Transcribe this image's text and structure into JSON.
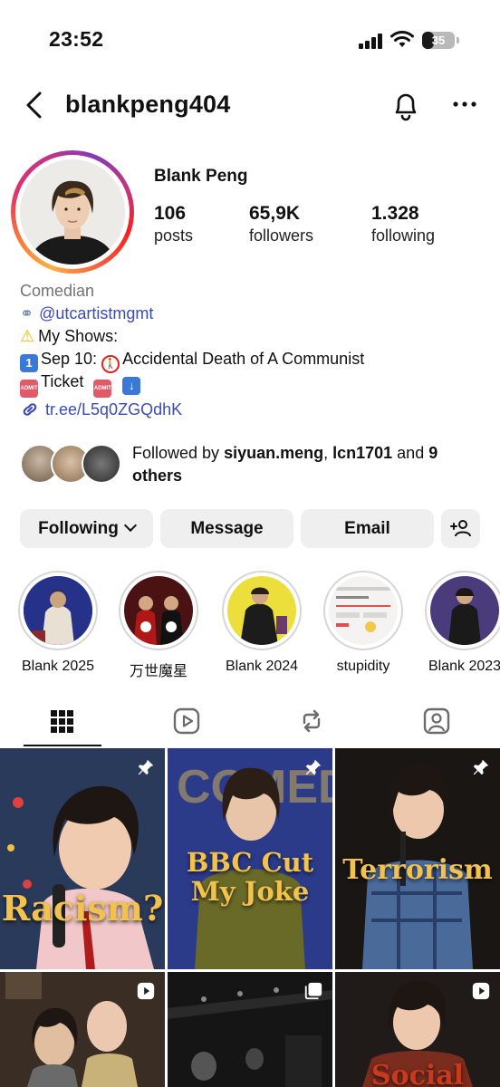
{
  "status_bar": {
    "time": "23:52",
    "battery": "35",
    "battery_level": 0.35
  },
  "header": {
    "username": "blankpeng404"
  },
  "profile": {
    "display_name": "Blank Peng",
    "stats": [
      {
        "value": "106",
        "label": "posts"
      },
      {
        "value": "65,9K",
        "label": "followers"
      },
      {
        "value": "1.328",
        "label": "following"
      }
    ]
  },
  "bio": {
    "category": "Comedian",
    "mention": "@utcartistmgmt",
    "shows_heading": "My Shows:",
    "show_line": "Sep 10: ",
    "show_title": "Accidental Death of A Communist",
    "ticket": "Ticket",
    "link": "tr.ee/L5q0ZGQdhK"
  },
  "followed_by": {
    "prefix": "Followed by ",
    "user1": "siyuan.meng",
    "sep": ", ",
    "user2": "lcn1701",
    "and": " and ",
    "others": "9 others"
  },
  "actions": {
    "following": "Following",
    "message": "Message",
    "email": "Email"
  },
  "highlights": [
    {
      "label": "Blank 2025",
      "bg": "#2b3a8f"
    },
    {
      "label": "万世魔星",
      "bg": "#5b1a1a"
    },
    {
      "label": "Blank 2024",
      "bg": "#e9d94a"
    },
    {
      "label": "stupidity",
      "bg": "#f4f1ef"
    },
    {
      "label": "Blank 2023",
      "bg": "#4a3b7c"
    }
  ],
  "tabs": [
    "grid-icon",
    "reels-icon",
    "reposts-icon",
    "tagged-icon"
  ],
  "posts": [
    {
      "title": "Racism?",
      "icon": "pin-icon"
    },
    {
      "title": "BBC Cut My Joke",
      "icon": "pin-icon"
    },
    {
      "title": "Terrorism",
      "icon": "pin-icon"
    },
    {
      "title": "",
      "icon": "reel-icon"
    },
    {
      "title": "",
      "icon": "carousel-icon"
    },
    {
      "title": "Social",
      "icon": "reel-icon"
    }
  ],
  "colors": {
    "link": "#3a4bb8",
    "button_bg": "#efefef",
    "caption_gold": "#f2c14e"
  }
}
